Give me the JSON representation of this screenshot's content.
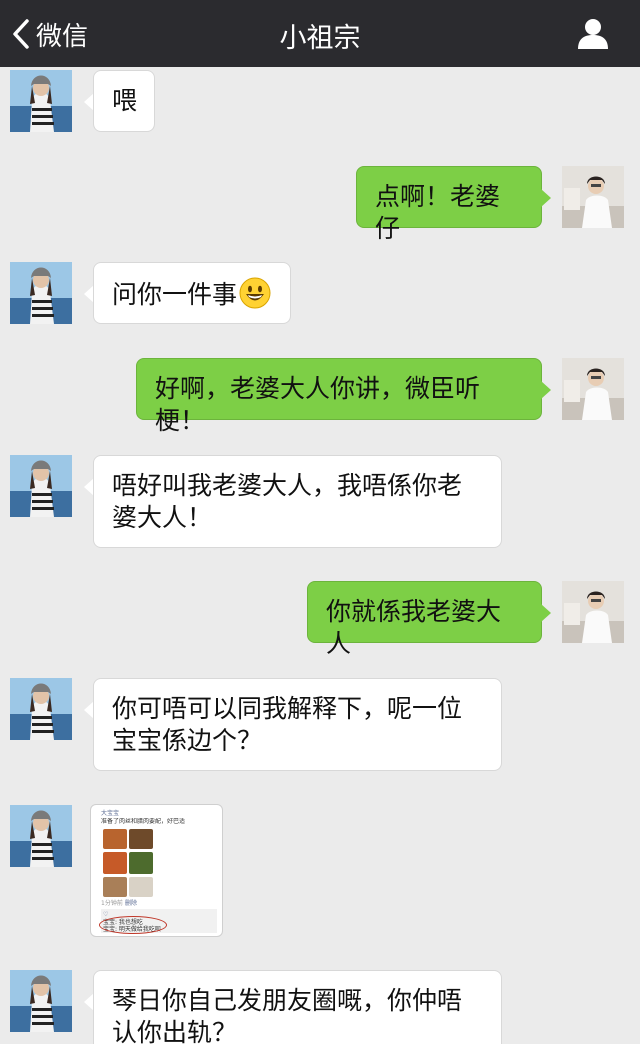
{
  "nav": {
    "back_label": "微信",
    "title": "小祖宗"
  },
  "messages": [
    {
      "side": "left",
      "text": "喂"
    },
    {
      "side": "right",
      "text": "点啊！老婆仔"
    },
    {
      "side": "left",
      "text": "问你一件事",
      "emoji": "smiley-emoji"
    },
    {
      "side": "right",
      "text": "好啊，老婆大人你讲，微臣听梗！"
    },
    {
      "side": "left",
      "text": "唔好叫我老婆大人，我唔係你老婆大人！"
    },
    {
      "side": "right",
      "text": "你就係我老婆大人"
    },
    {
      "side": "left",
      "text": "你可唔可以同我解释下，呢一位宝宝係边个？"
    },
    {
      "side": "left",
      "type": "image"
    },
    {
      "side": "left",
      "text": "琴日你自己发朋友圈嘅，你仲唔认你出轨？"
    }
  ],
  "screenshot": {
    "poster": "大宝宝",
    "caption": "准备了肉丝和腊肉要配，好巴适",
    "meta": "1分钟前",
    "action": "删除",
    "likes": "",
    "comment_1": "宝宝: 我也想吃",
    "comment_2": "宝宝: 明天做给我吃呗"
  },
  "colors": {
    "navbar": "#2b2b2f",
    "background": "#ebebeb",
    "bubble_right": "#7dcf46",
    "bubble_left": "#ffffff",
    "highlight_circle": "#c0392b"
  }
}
